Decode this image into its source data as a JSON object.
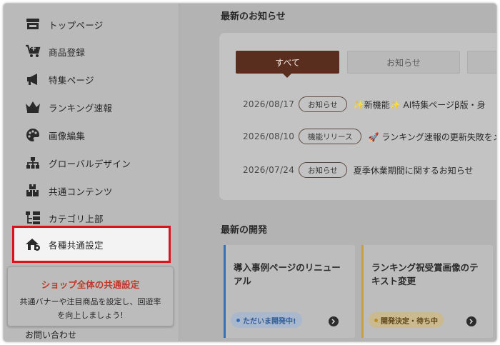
{
  "sidebar": {
    "items": [
      {
        "label": "トップページ",
        "icon": "store-icon"
      },
      {
        "label": "商品登録",
        "icon": "cart-add-icon"
      },
      {
        "label": "特集ページ",
        "icon": "megaphone-icon"
      },
      {
        "label": "ランキング速報",
        "icon": "crown-icon"
      },
      {
        "label": "画像編集",
        "icon": "palette-icon"
      },
      {
        "label": "グローバルデザイン",
        "icon": "sitemap-icon"
      },
      {
        "label": "共通コンテンツ",
        "icon": "boxes-icon"
      },
      {
        "label": "カテゴリ上部",
        "icon": "category-tree-icon"
      },
      {
        "label": "各種共通設定",
        "icon": "house-gear-icon"
      }
    ],
    "tooltip": {
      "title": "ショップ全体の共通設定",
      "body_line1": "共通バナーや注目商品を設定し、回遊率",
      "body_line2": "を向上しましょう!"
    },
    "contact_label": "お問い合わせ"
  },
  "news": {
    "title": "最新のお知らせ",
    "tabs": [
      {
        "label": "すべて",
        "active": true
      },
      {
        "label": "お知らせ",
        "active": false
      },
      {
        "label": "",
        "active": false
      }
    ],
    "items": [
      {
        "date": "2026/08/17",
        "badge": "お知らせ",
        "text": "✨新機能✨ AI特集ページβ版・身"
      },
      {
        "date": "2026/08/10",
        "badge": "機能リリース",
        "text": "🚀 ランキング速報の更新失敗をメ"
      },
      {
        "date": "2026/07/24",
        "badge": "お知らせ",
        "text": "夏季休業期間に関するお知らせ"
      }
    ]
  },
  "dev": {
    "title": "最新の開発",
    "cards": [
      {
        "title": "導入事例ページのリニューアル",
        "status": "ただいま開発中!",
        "accent": "#3a6fb8",
        "status_bg": "#a9b8cc",
        "status_color": "#2e5c96"
      },
      {
        "title": "ランキング祝受賞画像のテキスト変更",
        "status": "開発決定・待ち中",
        "accent": "#c9a040",
        "status_bg": "#cbb98f",
        "status_color": "#5a4415"
      },
      {
        "title": "",
        "status": "",
        "accent": "#c0392b"
      }
    ]
  },
  "colors": {
    "brand_dark": "#5a2e1e",
    "highlight_red": "#d9141b",
    "tooltip_title": "#c0392b"
  }
}
